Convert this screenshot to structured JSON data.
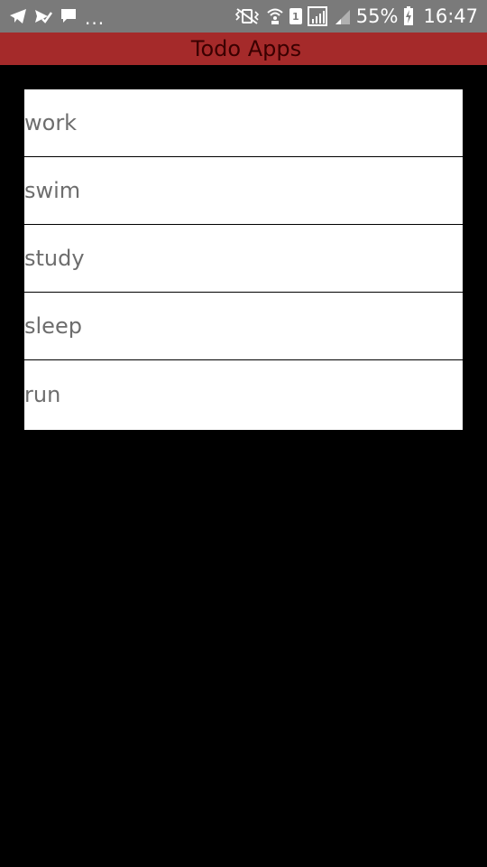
{
  "status_bar": {
    "left_icons": [
      "telegram-icon",
      "send-check-icon",
      "chat-bubble-icon"
    ],
    "overflow_text": "...",
    "right_icons": [
      "vibrate-mute-icon",
      "wifi-call-icon",
      "sim-1-icon",
      "signal-icon",
      "signal-weak-icon",
      "battery-charging-icon"
    ],
    "sim_label": "1",
    "battery_percent": "55%",
    "time": "16:47"
  },
  "app_bar": {
    "title": "Todo Apps",
    "background": "#a52a2a"
  },
  "todos": [
    {
      "text": "work"
    },
    {
      "text": "swim"
    },
    {
      "text": "study"
    },
    {
      "text": "sleep"
    },
    {
      "text": "run"
    }
  ]
}
